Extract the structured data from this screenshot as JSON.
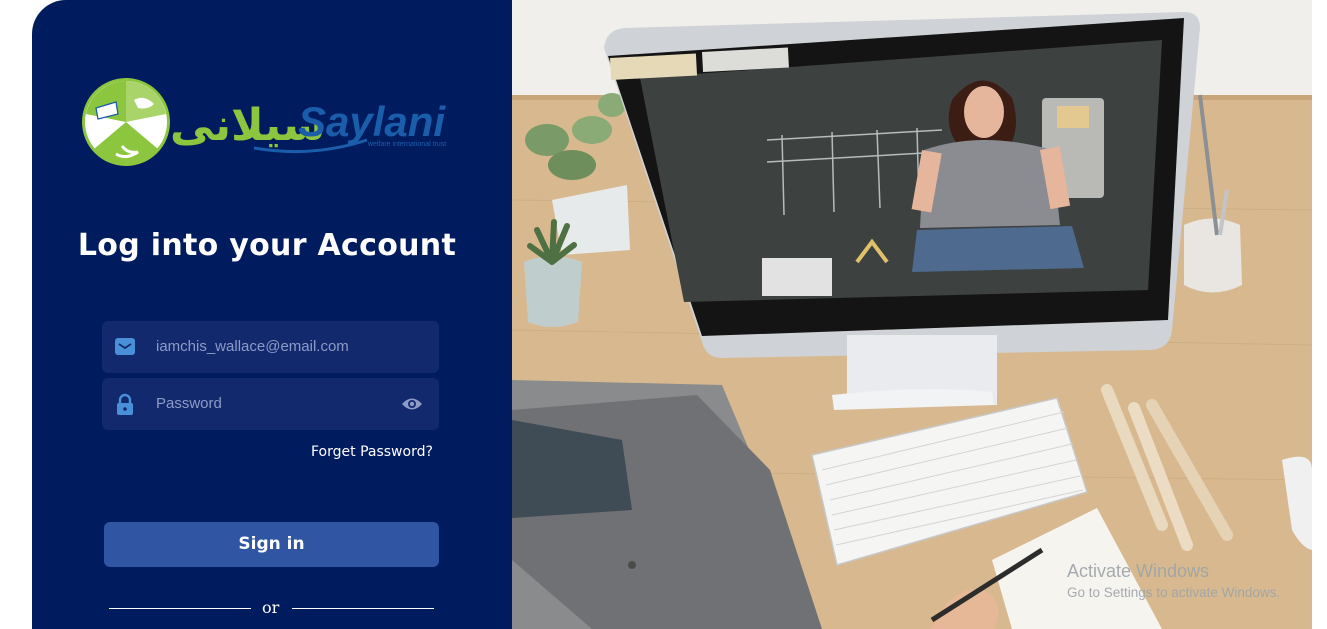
{
  "logo": {
    "arabic_text": "سيلانى",
    "latin_text": "Saylani",
    "tagline": "welfare international trust"
  },
  "login": {
    "title": "Log into your Account",
    "email_value": "iamchis_wallace@email.com",
    "password_placeholder": "Password",
    "forget_label": "Forget Password?",
    "signin_label": "Sign in",
    "or_label": "or"
  },
  "icons": {
    "email": "envelope-icon",
    "password": "lock-icon",
    "visibility": "eye-icon"
  },
  "colors": {
    "panel_bg": "#001c5e",
    "field_bg": "#12296e",
    "button_bg": "#2f55a3",
    "icon_blue": "#4a90d9",
    "logo_green": "#8cc63f",
    "logo_blue": "#1a5dab"
  },
  "watermark": {
    "line1": "Activate Windows",
    "line2": "Go to Settings to activate Windows."
  }
}
